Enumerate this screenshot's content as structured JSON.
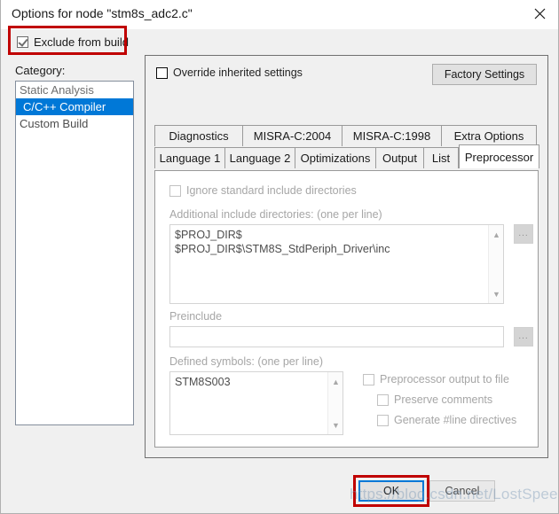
{
  "window": {
    "title": "Options for node \"stm8s_adc2.c\"",
    "close_icon": "close-icon"
  },
  "exclude": {
    "label": "Exclude from build",
    "checked": true
  },
  "category": {
    "label": "Category:",
    "items": [
      {
        "label": "Static Analysis",
        "selected": false
      },
      {
        "label": "C/C++ Compiler",
        "selected": true
      },
      {
        "label": "Custom Build",
        "selected": false
      }
    ],
    "selected_color": "#0078d7"
  },
  "panel": {
    "override": {
      "label": "Override inherited settings",
      "checked": false
    },
    "factory_settings_label": "Factory Settings"
  },
  "tabs": {
    "row1": [
      "Diagnostics",
      "MISRA-C:2004",
      "MISRA-C:1998",
      "Extra Options"
    ],
    "row2": [
      "Language 1",
      "Language 2",
      "Optimizations",
      "Output",
      "List"
    ],
    "active": "Preprocessor"
  },
  "preprocessor": {
    "ignore_standard_includes": {
      "label": "Ignore standard include directories",
      "checked": false
    },
    "additional_includes": {
      "label": "Additional include directories: (one per line)",
      "value_line1": "$PROJ_DIR$",
      "value_line2": "$PROJ_DIR$\\STM8S_StdPeriph_Driver\\inc",
      "browse_label": "..."
    },
    "preinclude": {
      "label": "Preinclude",
      "value": "",
      "browse_label": "..."
    },
    "defined_symbols": {
      "label": "Defined symbols: (one per line)",
      "value_line1": "STM8S003"
    },
    "output_options": [
      {
        "label": "Preprocessor output to file",
        "checked": false
      },
      {
        "label": "Preserve comments",
        "checked": false
      },
      {
        "label": "Generate #line directives",
        "checked": false
      }
    ]
  },
  "footer": {
    "ok_label": "OK",
    "cancel_label": "Cancel",
    "watermark": "https://blog.csdn.net/LostSpeed"
  }
}
